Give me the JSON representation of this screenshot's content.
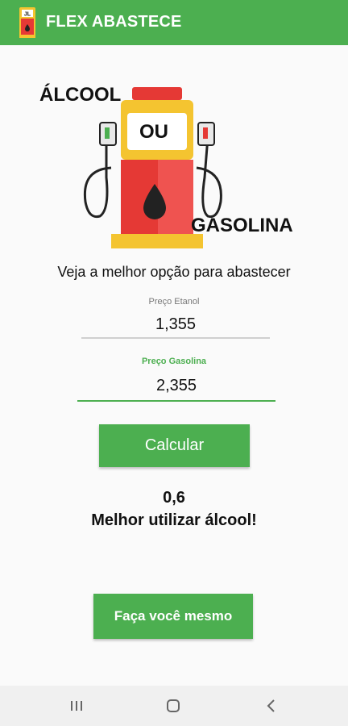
{
  "appbar": {
    "title": "FLEX ABASTECE",
    "icon": "fuel-pump-app-icon",
    "color": "#4caf50"
  },
  "logo": {
    "word_top": "ÁLCOOL",
    "word_middle": "OU",
    "word_bottom": "GASOLINA",
    "icon": "fuel-pump-illustration"
  },
  "subtitle": "Veja a melhor opção para abastecer",
  "form": {
    "etanol": {
      "label": "Preço  Etanol",
      "value": "1,355"
    },
    "gasolina": {
      "label": "Preço Gasolina",
      "value": "2,355"
    }
  },
  "actions": {
    "calculate_label": "Calcular",
    "diy_label": "Faça você mesmo"
  },
  "result": {
    "value": "0,6",
    "message": "Melhor utilizar álcool!"
  },
  "navbar": {
    "recent_icon": "recent-apps-icon",
    "home_icon": "home-icon",
    "back_icon": "back-icon"
  }
}
